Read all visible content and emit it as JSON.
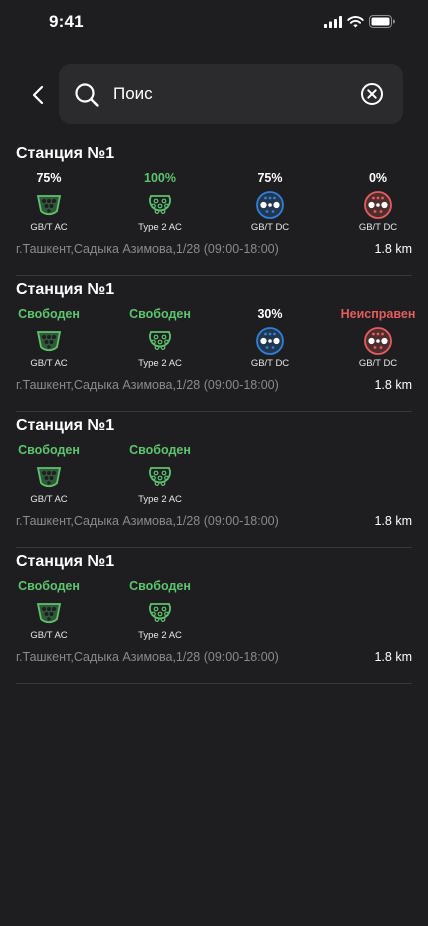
{
  "status_bar": {
    "time": "9:41"
  },
  "search": {
    "value": "Поис"
  },
  "colors": {
    "green": "#5cc46d",
    "blue": "#2e7fd8",
    "red": "#e35d5d",
    "white": "#ffffff"
  },
  "stations": [
    {
      "title": "Станция №1",
      "address": "г.Ташкент,Садыка Азимова,1/28 (09:00-18:00)",
      "distance": "1.8 km",
      "connectors": [
        {
          "status": "75%",
          "status_color": "white",
          "icon": "gbt-ac-connector-icon",
          "icon_color": "green",
          "label": "GB/T AC"
        },
        {
          "status": "100%",
          "status_color": "green",
          "icon": "type2-ac-connector-icon",
          "icon_color": "green",
          "label": "Type 2 AC"
        },
        {
          "status": "75%",
          "status_color": "white",
          "icon": "gbt-dc-connector-icon",
          "icon_color": "blue",
          "label": "GB/T DC"
        },
        {
          "status": "0%",
          "status_color": "white",
          "icon": "gbt-dc-connector-icon",
          "icon_color": "red",
          "label": "GB/T DC"
        }
      ]
    },
    {
      "title": "Станция №1",
      "address": "г.Ташкент,Садыка Азимова,1/28 (09:00-18:00)",
      "distance": "1.8 km",
      "connectors": [
        {
          "status": "Свободен",
          "status_color": "green",
          "icon": "gbt-ac-connector-icon",
          "icon_color": "green",
          "label": "GB/T AC"
        },
        {
          "status": "Свободен",
          "status_color": "green",
          "icon": "type2-ac-connector-icon",
          "icon_color": "green",
          "label": "Type 2 AC"
        },
        {
          "status": "30%",
          "status_color": "white",
          "icon": "gbt-dc-connector-icon",
          "icon_color": "blue",
          "label": "GB/T DC"
        },
        {
          "status": "Неисправен",
          "status_color": "red",
          "icon": "gbt-dc-connector-icon",
          "icon_color": "red",
          "label": "GB/T DC"
        }
      ]
    },
    {
      "title": "Станция №1",
      "address": "г.Ташкент,Садыка Азимова,1/28 (09:00-18:00)",
      "distance": "1.8 km",
      "connectors": [
        {
          "status": "Свободен",
          "status_color": "green",
          "icon": "gbt-ac-connector-icon",
          "icon_color": "green",
          "label": "GB/T AC"
        },
        {
          "status": "Свободен",
          "status_color": "green",
          "icon": "type2-ac-connector-icon",
          "icon_color": "green",
          "label": "Type 2 AC"
        }
      ]
    },
    {
      "title": "Станция №1",
      "address": "г.Ташкент,Садыка Азимова,1/28 (09:00-18:00)",
      "distance": "1.8 km",
      "connectors": [
        {
          "status": "Свободен",
          "status_color": "green",
          "icon": "gbt-ac-connector-icon",
          "icon_color": "green",
          "label": "GB/T AC"
        },
        {
          "status": "Свободен",
          "status_color": "green",
          "icon": "type2-ac-connector-icon",
          "icon_color": "green",
          "label": "Type 2 AC"
        }
      ]
    }
  ]
}
